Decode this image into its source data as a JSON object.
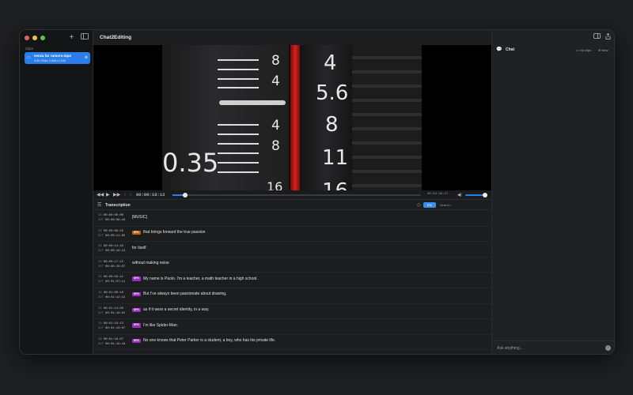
{
  "sidebar": {
    "section_label": "Clips",
    "clip": {
      "name": "senza far rumore.mp4",
      "meta": "4:36   29fps   2,840×2,160"
    }
  },
  "main": {
    "title": "Chat2Editing",
    "player": {
      "timecode": "00:00:18:13",
      "duration": "00:04:36:17",
      "progress": 0.05,
      "volume": 1.0
    },
    "transcription": {
      "title": "Transcription",
      "lang_badge": "EN",
      "search_placeholder": "Search..."
    },
    "rows": [
      {
        "in": "00:00:00:00",
        "out": "00:00:08:16",
        "speaker": "",
        "speaker_color": "",
        "text": "[MUSIC]"
      },
      {
        "in": "00:00:08:16",
        "out": "00:00:11:05",
        "speaker": "SP1",
        "speaker_color": "#b8650f",
        "text": "that brings forward the true passion"
      },
      {
        "in": "00:00:14:10",
        "out": "00:00:16:13",
        "speaker": "",
        "speaker_color": "",
        "text": "for itself"
      },
      {
        "in": "00:00:17:15",
        "out": "00:00:20:07",
        "speaker": "",
        "speaker_color": "",
        "text": "without making noise"
      },
      {
        "in": "00:00:59:11",
        "out": "00:01:07:11",
        "speaker": "SP2",
        "speaker_color": "#9b2fbd",
        "text": "My name is Paolo. I'm a teacher, a math teacher in a high school."
      },
      {
        "in": "00:01:08:18",
        "out": "00:01:12:13",
        "speaker": "SP2",
        "speaker_color": "#9b2fbd",
        "text": "But I've always been passionate about drawing,"
      },
      {
        "in": "00:01:14:20",
        "out": "00:01:16:01",
        "speaker": "SP2",
        "speaker_color": "#9b2fbd",
        "text": "as if it were a secret identity, in a way."
      },
      {
        "in": "00:01:18:13",
        "out": "00:01:19:07",
        "speaker": "SP2",
        "speaker_color": "#9b2fbd",
        "text": "I'm like Spider-Man."
      },
      {
        "in": "00:01:19:07",
        "out": "00:01:19:18",
        "speaker": "SP2",
        "speaker_color": "#9b2fbd",
        "text": "No one knows that Peter Parker is a student, a boy, who has his private life."
      }
    ],
    "video_scale": {
      "left_upper": [
        "8",
        "4"
      ],
      "left_lower": [
        "4",
        "8"
      ],
      "right": [
        "4",
        "5.6",
        "8",
        "11",
        "16"
      ],
      "aperture_left": "0.35",
      "bottom_left": "16"
    }
  },
  "chat": {
    "title": "Chat",
    "no_clips": "No clips",
    "new_label": "New",
    "placeholder": "Ask anything..."
  }
}
